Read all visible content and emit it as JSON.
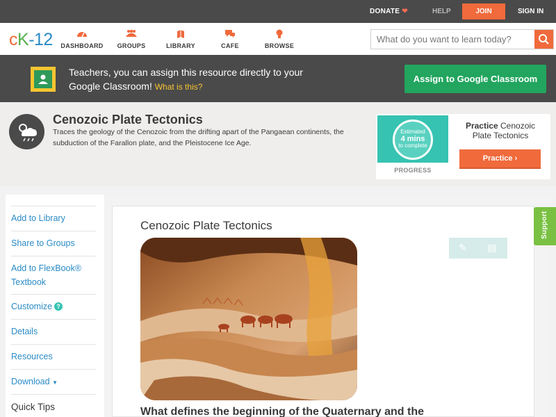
{
  "topbar": {
    "donate": "DONATE",
    "help": "HELP",
    "join": "JOIN",
    "signin": "SIGN IN"
  },
  "nav": {
    "logo": {
      "c": "c",
      "k": "K",
      "dash": "-",
      "num": "12"
    },
    "items": [
      {
        "label": "DASHBOARD",
        "icon": "dashboard-icon"
      },
      {
        "label": "GROUPS",
        "icon": "groups-icon"
      },
      {
        "label": "LIBRARY",
        "icon": "library-icon"
      },
      {
        "label": "CAFE",
        "icon": "cafe-icon"
      },
      {
        "label": "BROWSE",
        "icon": "browse-icon"
      }
    ],
    "search_placeholder": "What do you want to learn today?"
  },
  "google_banner": {
    "text": "Teachers, you can assign this resource directly to your Google Classroom!",
    "what": "What is this?",
    "button": "Assign to Google Classroom"
  },
  "header": {
    "title": "Cenozoic Plate Tectonics",
    "description": "Traces the geology of the Cenozoic from the drifting apart of the Pangaean continents, the subduction of the Farallon plate, and the Pleistocene Ice Age."
  },
  "practice": {
    "estimated": "Estimated",
    "mins": "4 mins",
    "to_complete": "to complete",
    "progress_label": "PROGRESS",
    "title_bold": "Practice",
    "title_rest": "Cenozoic Plate Tectonics",
    "button": "Practice"
  },
  "sidebar": {
    "items": [
      "Add to Library",
      "Share to Groups",
      "Add to FlexBook®",
      "Textbook",
      "Customize",
      "Details",
      "Resources",
      "Download",
      "Quick Tips"
    ]
  },
  "content": {
    "title": "Cenozoic Plate Tectonics",
    "heading": "What defines the beginning of the Quaternary and the"
  },
  "support": "Support",
  "colors": {
    "accent": "#f06a3c",
    "link": "#2a8bc6",
    "green": "#22a55e",
    "dark": "#4a4a4a"
  }
}
